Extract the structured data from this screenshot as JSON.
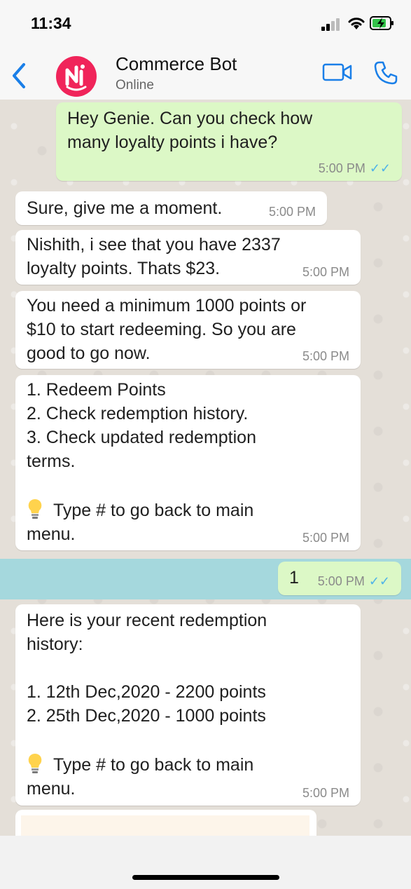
{
  "status_bar": {
    "time": "11:34"
  },
  "header": {
    "title": "Commerce Bot",
    "subtitle": "Online"
  },
  "messages": [
    {
      "dir": "out",
      "text": "Hey Genie. Can you check how\nmany loyalty points i have?",
      "time": "5:00 PM",
      "read": true
    },
    {
      "dir": "in",
      "text": "Sure, give me a moment.",
      "time": "5:00 PM"
    },
    {
      "dir": "in",
      "text": "Nishith, i see that you have 2337\nloyalty points. Thats $23.",
      "time": "5:00 PM"
    },
    {
      "dir": "in",
      "text": "You need a minimum 1000 points or\n$10 to start redeeming. So you are\ngood to go now.",
      "time": "5:00 PM"
    },
    {
      "dir": "in",
      "text": "1. Redeem Points\n2. Check redemption history.\n3. Check updated redemption\nterms.",
      "hint": "Type # to go back to main\nmenu.",
      "time": "5:00 PM"
    },
    {
      "dir": "out",
      "text": "1",
      "time": "5:00 PM",
      "read": true
    },
    {
      "dir": "in",
      "text": "Here is your recent redemption\nhistory:\n\n1. 12th Dec,2020 - 2200 points\n2. 25th Dec,2020 - 1000 points",
      "hint": "Type # to go back to main\nmenu.",
      "time": "5:00 PM"
    }
  ],
  "read_ticks": "✓✓",
  "colors": {
    "incoming": "#ffffff",
    "outgoing": "#dcf8c6",
    "accent": "#1a7fe8",
    "avatar": "#f0245a",
    "selected_row": "#a5d8dd"
  },
  "icons": [
    "back-chevron-icon",
    "bot-avatar-icon",
    "video-call-icon",
    "phone-call-icon",
    "lightbulb-icon",
    "double-check-icon"
  ]
}
